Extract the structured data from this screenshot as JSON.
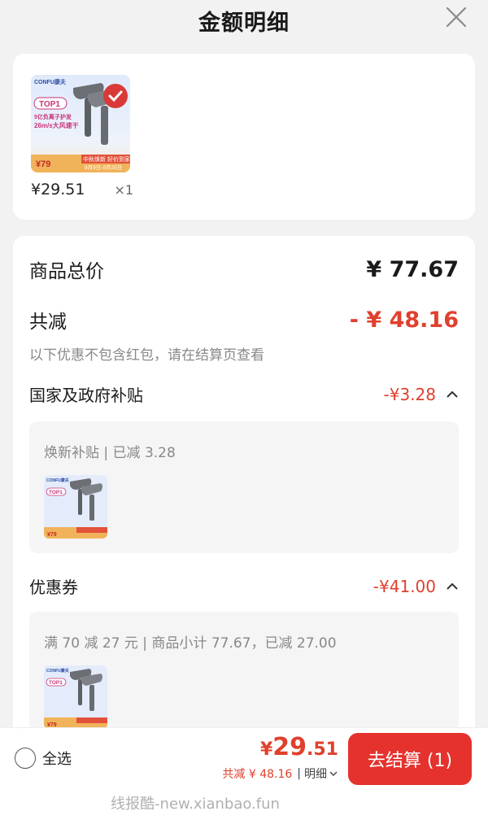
{
  "header": {
    "title": "金额明细"
  },
  "product": {
    "image": {
      "brand": "CONFU康夫",
      "badge": "TOP1",
      "headline_1": "5亿负离子护发",
      "headline_2": "26m/s大风速干",
      "promo_banner": "中秋焕新 好价到家",
      "promo_dates": "9月9日-9月25日",
      "promo_price": "¥79"
    },
    "price": "¥29.51",
    "quantity": "×1"
  },
  "summary": {
    "total_label": "商品总价",
    "total_value": "¥ 77.67",
    "discount_label": "共减",
    "discount_value": "- ¥ 48.16",
    "note": "以下优惠不包含红包，请在结算页查看"
  },
  "subsidy": {
    "label": "国家及政府补贴",
    "value": "-¥3.28",
    "detail": "焕新补贴 | 已减 3.28"
  },
  "coupon": {
    "label": "优惠券",
    "value": "-¥41.00",
    "detail": "满 70 减 27 元 | 商品小计 77.67，已减 27.00"
  },
  "bottom": {
    "select_all": "全选",
    "price_yen": "¥",
    "price_int": "29",
    "price_dec": ".51",
    "discount_text": "共减 ¥ 48.16",
    "separator": "|",
    "detail_link": "明细",
    "checkout": "去结算 (1)"
  },
  "watermark": "线报酷-new.xianbao.fun",
  "colors": {
    "accent_red": "#e0402d",
    "button_red": "#e5322d"
  }
}
